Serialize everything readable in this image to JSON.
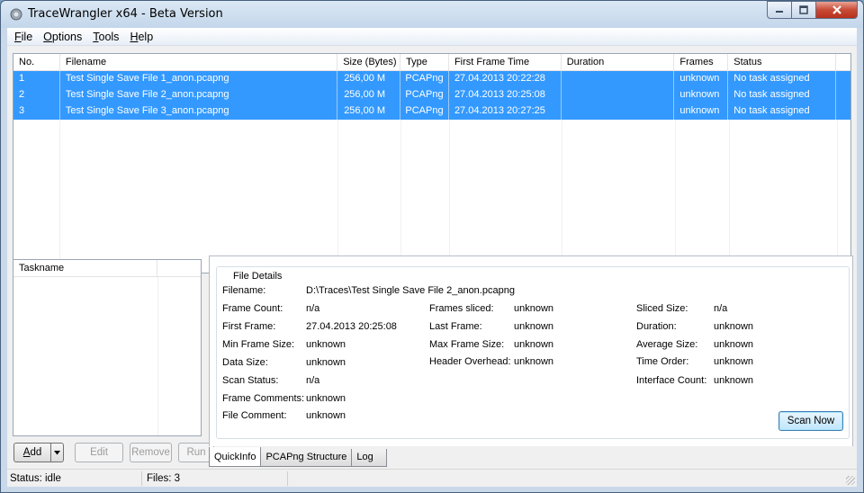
{
  "window": {
    "title": "TraceWrangler x64 - Beta Version",
    "icon": "app-icon",
    "controls": [
      "minimize-icon",
      "maximize-icon",
      "close-icon"
    ]
  },
  "menu": [
    {
      "label": "File",
      "accel": "F",
      "rest": "ile"
    },
    {
      "label": "Options",
      "accel": "O",
      "rest": "ptions"
    },
    {
      "label": "Tools",
      "accel": "T",
      "rest": "ools"
    },
    {
      "label": "Help",
      "accel": "H",
      "rest": "elp"
    }
  ],
  "file_list": {
    "columns": [
      "No.",
      "Filename",
      "Size (Bytes)",
      "Type",
      "First Frame Time",
      "Duration",
      "Frames",
      "Status"
    ],
    "rows": [
      {
        "no": "1",
        "filename": "Test Single Save File 1_anon.pcapng",
        "size": "256,00 M",
        "type": "PCAPng",
        "first_frame": "27.04.2013 20:22:28",
        "duration": "",
        "frames": "unknown",
        "status": "No task assigned"
      },
      {
        "no": "2",
        "filename": "Test Single Save File 2_anon.pcapng",
        "size": "256,00 M",
        "type": "PCAPng",
        "first_frame": "27.04.2013 20:25:08",
        "duration": "",
        "frames": "unknown",
        "status": "No task assigned"
      },
      {
        "no": "3",
        "filename": "Test Single Save File 3_anon.pcapng",
        "size": "256,00 M",
        "type": "PCAPng",
        "first_frame": "27.04.2013 20:27:25",
        "duration": "",
        "frames": "unknown",
        "status": "No task assigned"
      }
    ],
    "selection_color": "#3399ff"
  },
  "tasks": {
    "header": "Taskname",
    "buttons": {
      "add_accel": "A",
      "add_rest": "dd",
      "edit": "Edit",
      "remove": "Remove",
      "run": "Run"
    }
  },
  "details": {
    "title": "File Details",
    "filename_label": "Filename:",
    "filename_value": "D:\\Traces\\Test Single Save File 2_anon.pcapng",
    "col1": [
      {
        "label": "Frame Count:",
        "value": "n/a"
      },
      {
        "label": "First Frame:",
        "value": "27.04.2013 20:25:08"
      },
      {
        "label": "Min Frame Size:",
        "value": "unknown"
      },
      {
        "label": "Data Size:",
        "value": "unknown"
      },
      {
        "label": "Scan Status:",
        "value": "n/a"
      },
      {
        "label": "Frame Comments:",
        "value": "unknown"
      },
      {
        "label": "File Comment:",
        "value": "unknown"
      }
    ],
    "col2": [
      {
        "label": "Frames sliced:",
        "value": "unknown"
      },
      {
        "label": "Last Frame:",
        "value": "unknown"
      },
      {
        "label": "Max Frame Size:",
        "value": "unknown"
      },
      {
        "label": "Header Overhead:",
        "value": "unknown"
      }
    ],
    "col3": [
      {
        "label": "Sliced Size:",
        "value": "n/a"
      },
      {
        "label": "Duration:",
        "value": "unknown"
      },
      {
        "label": "Average Size:",
        "value": "unknown"
      },
      {
        "label": "Time Order:",
        "value": "unknown"
      },
      {
        "label": "Interface Count:",
        "value": "unknown"
      }
    ],
    "scan_button": "Scan Now"
  },
  "tabs": [
    "QuickInfo",
    "PCAPng Structure",
    "Log"
  ],
  "status": {
    "status": "Status: idle",
    "files": "Files: 3"
  }
}
